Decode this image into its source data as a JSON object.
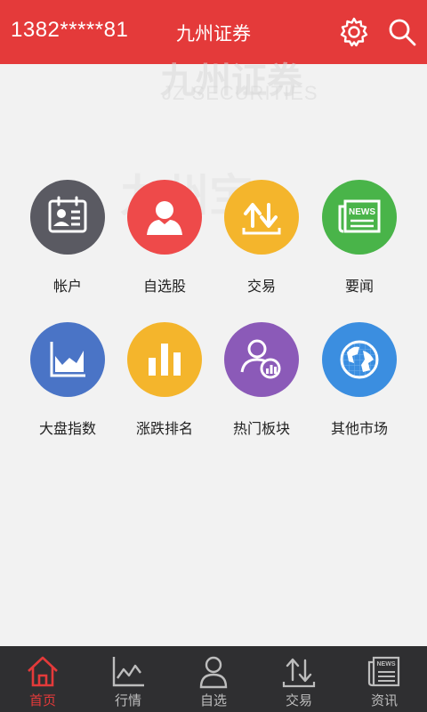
{
  "header": {
    "account": "1382*****81",
    "title": "九州证券",
    "settings_icon": "gear-icon",
    "search_icon": "search-icon"
  },
  "watermark": {
    "brand_cn": "九州证券",
    "brand_en": "JZ SECURITIES",
    "app_name": "九州宝"
  },
  "grid": {
    "items": [
      {
        "label": "帐户",
        "icon": "account-card-icon",
        "color": "#5a5a62"
      },
      {
        "label": "自选股",
        "icon": "person-icon",
        "color": "#ee4a4a"
      },
      {
        "label": "交易",
        "icon": "trade-arrows-icon",
        "color": "#f4b52c"
      },
      {
        "label": "要闻",
        "icon": "news-icon",
        "color": "#49b449"
      },
      {
        "label": "大盘指数",
        "icon": "area-chart-icon",
        "color": "#4a74c6"
      },
      {
        "label": "涨跌排名",
        "icon": "bar-chart-icon",
        "color": "#f4b52c"
      },
      {
        "label": "热门板块",
        "icon": "people-chart-icon",
        "color": "#8b5ab8"
      },
      {
        "label": "其他市场",
        "icon": "globe-icon",
        "color": "#3b8ee0"
      }
    ],
    "news_badge": "NEWS"
  },
  "tabbar": {
    "tabs": [
      {
        "label": "首页",
        "icon": "home-icon",
        "active": true
      },
      {
        "label": "行情",
        "icon": "market-chart-icon",
        "active": false
      },
      {
        "label": "自选",
        "icon": "user-icon",
        "active": false
      },
      {
        "label": "交易",
        "icon": "updown-arrows-icon",
        "active": false
      },
      {
        "label": "资讯",
        "icon": "news-doc-icon",
        "active": false
      }
    ],
    "news_badge": "NEWS"
  },
  "colors": {
    "header_bg": "#e43a3a",
    "tabbar_bg": "#2f2f31",
    "active_tab": "#e43a3a",
    "inactive_tab": "#bdbdbd"
  }
}
